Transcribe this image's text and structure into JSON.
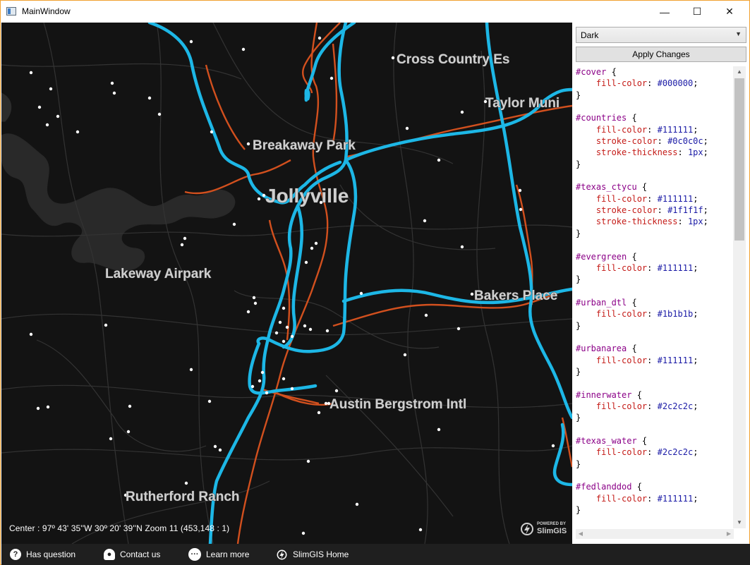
{
  "window": {
    "title": "MainWindow",
    "minimize_glyph": "—",
    "maximize_glyph": "☐",
    "close_glyph": "✕"
  },
  "map": {
    "labels": [
      "Cross Country Es",
      "Taylor Muni",
      "Breakaway Park",
      "Jollyville",
      "Lakeway Airpark",
      "Bakers Place",
      "Austin Bergstrom Intl",
      "Rutherford Ranch"
    ],
    "status": "Center : 97º 43' 35''W 30º 20' 39''N   Zoom 11 (453,148 : 1)",
    "powered_small": "POWERED BY",
    "powered_brand": "SlimGIS",
    "colors": {
      "background": "#131313",
      "highway": "#1db7e6",
      "major_road": "#d2501e",
      "minor_road": "#333333",
      "water": "#2c2c2c",
      "urban": "#1b1b1b"
    }
  },
  "side_panel": {
    "theme_selected": "Dark",
    "apply_label": "Apply Changes",
    "style_blocks": [
      {
        "selector": "#cover",
        "props": [
          [
            "fill-color",
            "#000000"
          ]
        ]
      },
      {
        "selector": "#countries",
        "props": [
          [
            "fill-color",
            "#111111"
          ],
          [
            "stroke-color",
            "#0c0c0c"
          ],
          [
            "stroke-thickness",
            "1px"
          ]
        ]
      },
      {
        "selector": "#texas_ctycu",
        "props": [
          [
            "fill-color",
            "#111111"
          ],
          [
            "stroke-color",
            "#1f1f1f"
          ],
          [
            "stroke-thickness",
            "1px"
          ]
        ]
      },
      {
        "selector": "#evergreen",
        "props": [
          [
            "fill-color",
            "#111111"
          ]
        ]
      },
      {
        "selector": "#urban_dtl",
        "props": [
          [
            "fill-color",
            "#1b1b1b"
          ]
        ]
      },
      {
        "selector": "#urbanarea",
        "props": [
          [
            "fill-color",
            "#111111"
          ]
        ]
      },
      {
        "selector": "#innerwater",
        "props": [
          [
            "fill-color",
            "#2c2c2c"
          ]
        ]
      },
      {
        "selector": "#texas_water",
        "props": [
          [
            "fill-color",
            "#2c2c2c"
          ]
        ]
      },
      {
        "selector": "#fedlanddod",
        "props": [
          [
            "fill-color",
            "#111111"
          ]
        ]
      }
    ]
  },
  "footer": {
    "items": [
      {
        "label": "Has question",
        "icon": "question-icon"
      },
      {
        "label": "Contact us",
        "icon": "person-icon"
      },
      {
        "label": "Learn more",
        "icon": "chat-icon"
      },
      {
        "label": "SlimGIS Home",
        "icon": "slimgis-logo-icon"
      }
    ]
  }
}
